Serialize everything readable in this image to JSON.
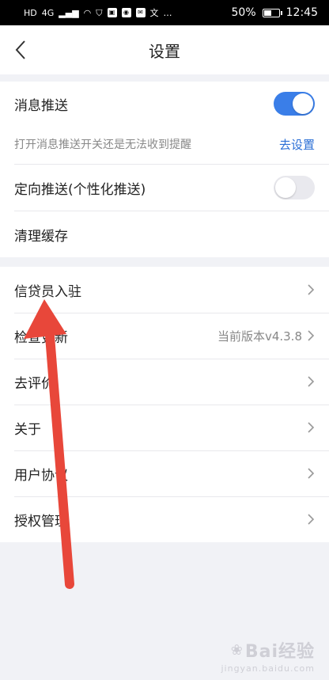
{
  "status_bar": {
    "left_icons": [
      "HD",
      "4G",
      "signal",
      "wifi",
      "shield",
      "app1",
      "app2",
      "mail",
      "文",
      "…"
    ],
    "battery": "50%",
    "battery_level": 0.5,
    "time": "12:45"
  },
  "nav": {
    "title": "设置"
  },
  "group1": {
    "push": {
      "label": "消息推送",
      "enabled": true
    },
    "hint": {
      "text": "打开消息推送开关还是无法收到提醒",
      "link": "去设置"
    },
    "targeted": {
      "label": "定向推送(个性化推送)",
      "enabled": false
    },
    "cache": {
      "label": "清理缓存"
    }
  },
  "group2": {
    "items": [
      {
        "label": "信贷员入驻"
      },
      {
        "label": "检查更新",
        "value": "当前版本v4.3.8"
      },
      {
        "label": "去评价"
      },
      {
        "label": "关于"
      },
      {
        "label": "用户协议"
      },
      {
        "label": "授权管理"
      }
    ]
  },
  "watermark": {
    "text": "Bai经验",
    "sub": "jingyan.baidu.com"
  },
  "colors": {
    "accent": "#3a7ee8",
    "link": "#2b6fd6",
    "annotation_arrow": "#e8473a"
  }
}
